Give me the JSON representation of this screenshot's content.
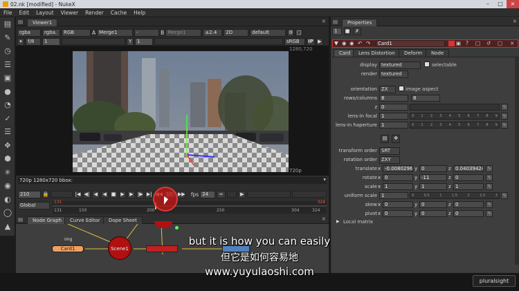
{
  "window": {
    "title": "02.nk [modified] - NukeX"
  },
  "menu": [
    "File",
    "Edit",
    "Layout",
    "Viewer",
    "Render",
    "Cache",
    "Help"
  ],
  "viewer": {
    "tab_label": "Viewer1",
    "channels": "rgba",
    "alpha": "rgba.",
    "rgb": "RGB",
    "input_a_label": "A",
    "input_a": "Merge1",
    "input_b_dash": "-",
    "input_b_label": "B",
    "input_b": "Merge1",
    "gain_label": "f/8",
    "gain_value": "1",
    "gamma_label": "Y",
    "gamma_value": "1",
    "zoom": "±2.4",
    "view_mode": "2D",
    "lut": "default",
    "colorspace": "sRGB",
    "ip": "IP",
    "res_corner": "1280,720",
    "res_bottom": "720p",
    "status_line": "720p 1280x720 bbox:",
    "frame": "210",
    "step": "10",
    "fps_label": "fps",
    "fps": "24",
    "range_mode": "Global",
    "ticks": [
      "131",
      "150",
      "200",
      "250",
      "304",
      "324"
    ],
    "range_start_marker": "131",
    "range_end_marker": "324"
  },
  "nodegraph": {
    "tabs": [
      "Node Graph",
      "Curve Editor",
      "Dope Sheet"
    ],
    "nodes": {
      "card": "Card1",
      "scene": "Scene1",
      "img": "img"
    }
  },
  "props": {
    "title": "Properties",
    "max_panels": "1",
    "node_name": "Card1",
    "tabs": [
      "Card",
      "Lens Distortion",
      "Deform",
      "Node"
    ],
    "display_label": "display",
    "display": "textured",
    "selectable_label": "selectable",
    "render_label": "render",
    "render": "textured",
    "orientation_label": "orientation",
    "orientation": "ZX",
    "image_aspect_label": "image aspect",
    "rows_label": "rows/columns",
    "rows": "8",
    "cols": "8",
    "z_label": "z",
    "z": "0",
    "lens_focal_label": "lens-in focal",
    "lens_focal": "1",
    "lens_hap_label": "lens-in haperture",
    "lens_hap": "1",
    "slider_ticks": [
      "0",
      "1",
      "2",
      "3",
      "4",
      "5",
      "6",
      "7",
      "8",
      "9"
    ],
    "transform_order_label": "transform order",
    "transform_order": "SRT",
    "rotation_order_label": "rotation order",
    "rotation_order": "ZXY",
    "translate_label": "translate",
    "translate": {
      "x": "-0.0080296",
      "y": "0",
      "z": "0.04039424"
    },
    "rotate_label": "rotate",
    "rotate": {
      "x": "0",
      "y": "-11",
      "z": "0"
    },
    "scale_label": "scale",
    "scale": {
      "x": "1",
      "y": "1",
      "z": "1"
    },
    "uniform_scale_label": "uniform scale",
    "uniform_scale": "1",
    "uniform_ticks": [
      "0",
      "0.5",
      "1",
      "1.5",
      "2",
      "2.5",
      "3"
    ],
    "skew_label": "skew",
    "skew": {
      "x": "0",
      "y": "0",
      "z": "0"
    },
    "pivot_label": "pivot",
    "pivot": {
      "x": "0",
      "y": "0",
      "z": "0"
    },
    "local_matrix_label": "Local matrix",
    "axis_x": "x",
    "axis_y": "y",
    "axis_z": "z"
  },
  "subtitle": {
    "line_en": "but it is how you can easily",
    "line_zh": "但它是如何容易地",
    "url": "www.yuyulaoshi.com"
  },
  "watermark": "pluralsight"
}
